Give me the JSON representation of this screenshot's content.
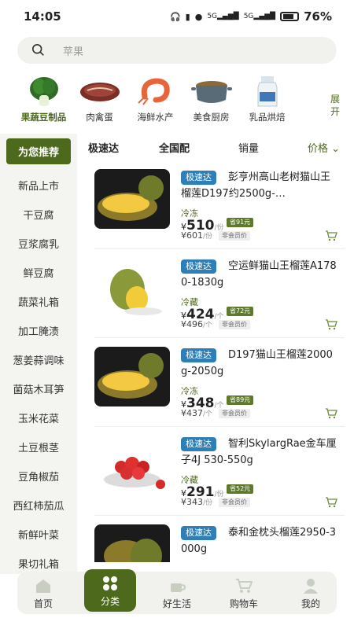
{
  "status": {
    "time": "14:05",
    "battery": "76%"
  },
  "search": {
    "placeholder": "苹果"
  },
  "categories": [
    {
      "label": "果蔬豆制品",
      "icon": "bok-choy-icon"
    },
    {
      "label": "肉禽蛋",
      "icon": "steak-icon"
    },
    {
      "label": "海鲜水产",
      "icon": "shrimp-icon"
    },
    {
      "label": "美食厨房",
      "icon": "pot-icon"
    },
    {
      "label": "乳品烘焙",
      "icon": "milk-icon"
    }
  ],
  "expand_label": "展开",
  "sidebar": [
    "为您推荐",
    "新品上市",
    "干豆腐",
    "豆浆腐乳",
    "鲜豆腐",
    "蔬菜礼箱",
    "加工腌渍",
    "葱姜蒜调味",
    "菌菇木耳笋",
    "玉米花菜",
    "土豆根茎",
    "豆角椒茄",
    "西红柿茄瓜",
    "新鲜叶菜",
    "果切礼箱"
  ],
  "sort": {
    "fast": "极速达",
    "nation": "全国配",
    "sales": "销量",
    "price": "价格"
  },
  "products": [
    {
      "tag": "极速达",
      "title": "彭亨州高山老树猫山王榴莲D197约2500g-…",
      "temp": "冷冻",
      "price": "510",
      "unit": "/份",
      "save": "省91元",
      "vip_price": "¥601",
      "vip_unit": "/份",
      "vip_label": "非会员价"
    },
    {
      "tag": "极速达",
      "title": "空运鲜猫山王榴莲A1780-1830g",
      "temp": "冷藏",
      "price": "424",
      "unit": "/个",
      "save": "省72元",
      "vip_price": "¥496",
      "vip_unit": "/个",
      "vip_label": "非会员价"
    },
    {
      "tag": "极速达",
      "title": "D197猫山王榴莲2000g-2050g",
      "temp": "冷冻",
      "price": "348",
      "unit": "/个",
      "save": "省89元",
      "vip_price": "¥437",
      "vip_unit": "/个",
      "vip_label": "非会员价"
    },
    {
      "tag": "极速达",
      "title": "智利SkylargRae金车厘子4J 530-550g",
      "temp": "冷藏",
      "price": "291",
      "unit": "/份",
      "save": "省52元",
      "vip_price": "¥343",
      "vip_unit": "/份",
      "vip_label": "非会员价"
    },
    {
      "tag": "极速达",
      "title": "泰和金枕头榴莲2950-3000g",
      "temp": "",
      "price": "",
      "unit": "",
      "save": "",
      "vip_price": "",
      "vip_unit": "",
      "vip_label": ""
    }
  ],
  "currency": "¥",
  "tabs": [
    "首页",
    "分类",
    "好生活",
    "购物车",
    "我的"
  ],
  "colors": {
    "accent": "#4d6a1c",
    "tag": "#2e7fb8"
  }
}
